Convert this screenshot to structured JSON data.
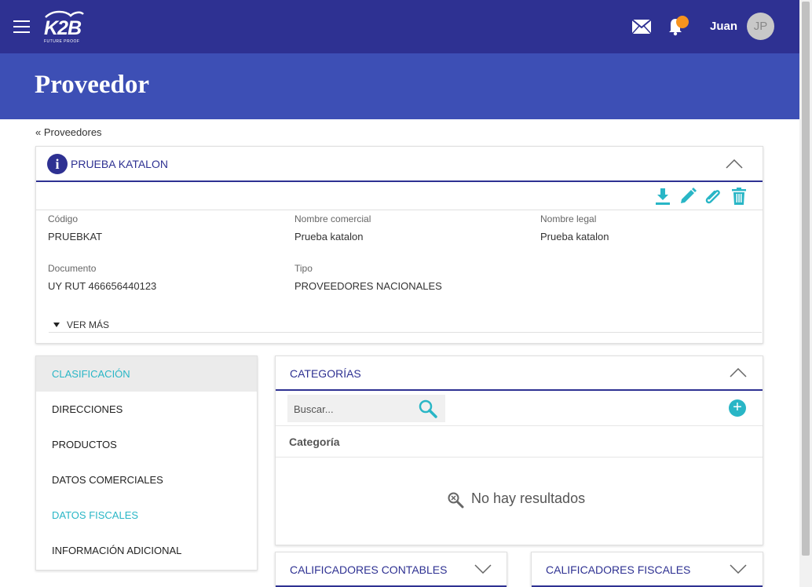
{
  "topbar": {
    "logo_text": "K2B",
    "logo_tagline": "FUTURE PROOF",
    "user_name": "Juan",
    "user_initials": "JP"
  },
  "header": {
    "title": "Proveedor"
  },
  "breadcrumb": {
    "text": "« Proveedores"
  },
  "info_card": {
    "title": "PRUEBA KATALON",
    "icon_letter": "i",
    "actions": [
      "download-icon",
      "pencil-icon",
      "paperclip-icon",
      "trash-icon"
    ],
    "fields": {
      "codigo": {
        "label": "Código",
        "value": "PRUEBKAT"
      },
      "nombre_comercial": {
        "label": "Nombre comercial",
        "value": "Prueba katalon"
      },
      "nombre_legal": {
        "label": "Nombre legal",
        "value": "Prueba katalon"
      },
      "documento": {
        "label": "Documento",
        "value": "UY RUT 466656440123"
      },
      "tipo": {
        "label": "Tipo",
        "value": "PROVEEDORES NACIONALES"
      }
    },
    "ver_mas": "VER MÁS"
  },
  "side_tabs": [
    {
      "label": "CLASIFICACIÓN",
      "state": "active"
    },
    {
      "label": "DIRECCIONES",
      "state": "normal"
    },
    {
      "label": "PRODUCTOS",
      "state": "normal"
    },
    {
      "label": "DATOS COMERCIALES",
      "state": "normal"
    },
    {
      "label": "DATOS FISCALES",
      "state": "highlight"
    },
    {
      "label": "INFORMACIÓN ADICIONAL",
      "state": "normal"
    }
  ],
  "categorias": {
    "title": "CATEGORÍAS",
    "search_placeholder": "Buscar...",
    "add_label": "+",
    "column_header": "Categoría",
    "empty_text": "No hay resultados"
  },
  "bottom_panels": {
    "contables": "CALIFICADORES CONTABLES",
    "fiscales": "CALIFICADORES FISCALES"
  },
  "colors": {
    "primary": "#2e3192",
    "header_band": "#3d4fb5",
    "accent": "#29b6c6",
    "notification": "#f7931e"
  }
}
